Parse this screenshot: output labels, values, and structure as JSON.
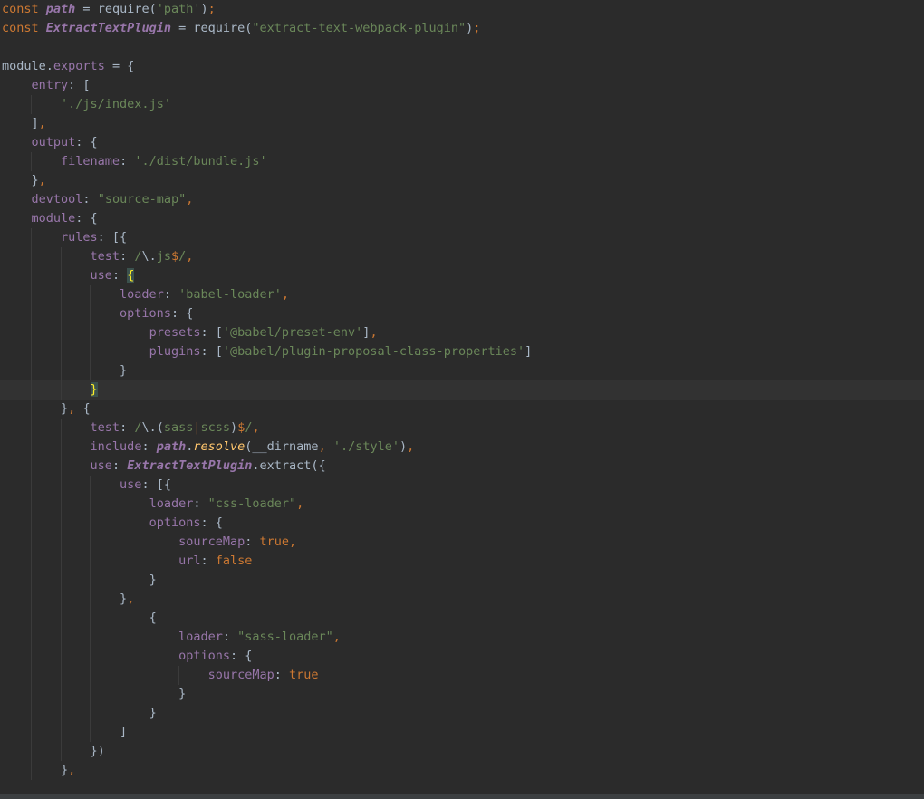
{
  "editor": {
    "language": "javascript",
    "current_line_index": 20,
    "lines": [
      [
        {
          "t": "const ",
          "c": "kw"
        },
        {
          "t": "path",
          "c": "globb"
        },
        {
          "t": " = ",
          "c": "plain"
        },
        {
          "t": "require",
          "c": "plain"
        },
        {
          "t": "(",
          "c": "plain"
        },
        {
          "t": "'path'",
          "c": "str"
        },
        {
          "t": ")",
          "c": "plain"
        },
        {
          "t": ";",
          "c": "punc"
        }
      ],
      [
        {
          "t": "const ",
          "c": "kw"
        },
        {
          "t": "ExtractTextPlugin",
          "c": "globb"
        },
        {
          "t": " = ",
          "c": "plain"
        },
        {
          "t": "require",
          "c": "plain"
        },
        {
          "t": "(",
          "c": "plain"
        },
        {
          "t": "\"extract-text-webpack-plugin\"",
          "c": "str"
        },
        {
          "t": ")",
          "c": "plain"
        },
        {
          "t": ";",
          "c": "punc"
        }
      ],
      [],
      [
        {
          "t": "module",
          "c": "plain"
        },
        {
          "t": ".",
          "c": "plain"
        },
        {
          "t": "exports",
          "c": "prop"
        },
        {
          "t": " = {",
          "c": "plain"
        }
      ],
      [
        {
          "t": "    ",
          "c": "plain"
        },
        {
          "t": "entry",
          "c": "prop"
        },
        {
          "t": ": [",
          "c": "plain"
        }
      ],
      [
        {
          "t": "        ",
          "c": "plain"
        },
        {
          "t": "'./js/index.js'",
          "c": "str"
        }
      ],
      [
        {
          "t": "    ",
          "c": "plain"
        },
        {
          "t": "]",
          "c": "plain"
        },
        {
          "t": ",",
          "c": "punc"
        }
      ],
      [
        {
          "t": "    ",
          "c": "plain"
        },
        {
          "t": "output",
          "c": "prop"
        },
        {
          "t": ": {",
          "c": "plain"
        }
      ],
      [
        {
          "t": "        ",
          "c": "plain"
        },
        {
          "t": "filename",
          "c": "prop"
        },
        {
          "t": ": ",
          "c": "plain"
        },
        {
          "t": "'./dist/bundle.js'",
          "c": "str"
        }
      ],
      [
        {
          "t": "    ",
          "c": "plain"
        },
        {
          "t": "}",
          "c": "plain"
        },
        {
          "t": ",",
          "c": "punc"
        }
      ],
      [
        {
          "t": "    ",
          "c": "plain"
        },
        {
          "t": "devtool",
          "c": "prop"
        },
        {
          "t": ": ",
          "c": "plain"
        },
        {
          "t": "\"source-map\"",
          "c": "str"
        },
        {
          "t": ",",
          "c": "punc"
        }
      ],
      [
        {
          "t": "    ",
          "c": "plain"
        },
        {
          "t": "module",
          "c": "prop"
        },
        {
          "t": ": {",
          "c": "plain"
        }
      ],
      [
        {
          "t": "        ",
          "c": "plain"
        },
        {
          "t": "rules",
          "c": "prop"
        },
        {
          "t": ": [{",
          "c": "plain"
        }
      ],
      [
        {
          "t": "            ",
          "c": "plain"
        },
        {
          "t": "test",
          "c": "prop"
        },
        {
          "t": ": ",
          "c": "plain"
        },
        {
          "t": "/",
          "c": "rx"
        },
        {
          "t": "\\.",
          "c": "plain"
        },
        {
          "t": "js",
          "c": "rx"
        },
        {
          "t": "$",
          "c": "rxs"
        },
        {
          "t": "/",
          "c": "rx"
        },
        {
          "t": ",",
          "c": "punc"
        }
      ],
      [
        {
          "t": "            ",
          "c": "plain"
        },
        {
          "t": "use",
          "c": "prop"
        },
        {
          "t": ": ",
          "c": "plain"
        },
        {
          "t": "{",
          "c": "brace-hl"
        }
      ],
      [
        {
          "t": "                ",
          "c": "plain"
        },
        {
          "t": "loader",
          "c": "prop"
        },
        {
          "t": ": ",
          "c": "plain"
        },
        {
          "t": "'babel-loader'",
          "c": "str"
        },
        {
          "t": ",",
          "c": "punc"
        }
      ],
      [
        {
          "t": "                ",
          "c": "plain"
        },
        {
          "t": "options",
          "c": "prop"
        },
        {
          "t": ": {",
          "c": "plain"
        }
      ],
      [
        {
          "t": "                    ",
          "c": "plain"
        },
        {
          "t": "presets",
          "c": "prop"
        },
        {
          "t": ": [",
          "c": "plain"
        },
        {
          "t": "'@babel/preset-env'",
          "c": "str"
        },
        {
          "t": "]",
          "c": "plain"
        },
        {
          "t": ",",
          "c": "punc"
        }
      ],
      [
        {
          "t": "                    ",
          "c": "plain"
        },
        {
          "t": "plugins",
          "c": "prop"
        },
        {
          "t": ": [",
          "c": "plain"
        },
        {
          "t": "'@babel/plugin-proposal-class-properties'",
          "c": "str"
        },
        {
          "t": "]",
          "c": "plain"
        }
      ],
      [
        {
          "t": "                ",
          "c": "plain"
        },
        {
          "t": "}",
          "c": "plain"
        }
      ],
      [
        {
          "t": "            ",
          "c": "plain"
        },
        {
          "t": "}",
          "c": "brace-hl"
        }
      ],
      [
        {
          "t": "        ",
          "c": "plain"
        },
        {
          "t": "}",
          "c": "plain"
        },
        {
          "t": ", ",
          "c": "punc"
        },
        {
          "t": "{",
          "c": "plain"
        }
      ],
      [
        {
          "t": "            ",
          "c": "plain"
        },
        {
          "t": "test",
          "c": "prop"
        },
        {
          "t": ": ",
          "c": "plain"
        },
        {
          "t": "/",
          "c": "rx"
        },
        {
          "t": "\\.",
          "c": "plain"
        },
        {
          "t": "(",
          "c": "plain"
        },
        {
          "t": "sass",
          "c": "rx"
        },
        {
          "t": "|",
          "c": "rxs"
        },
        {
          "t": "scss",
          "c": "rx"
        },
        {
          "t": ")",
          "c": "plain"
        },
        {
          "t": "$",
          "c": "rxs"
        },
        {
          "t": "/",
          "c": "rx"
        },
        {
          "t": ",",
          "c": "punc"
        }
      ],
      [
        {
          "t": "            ",
          "c": "plain"
        },
        {
          "t": "include",
          "c": "prop"
        },
        {
          "t": ": ",
          "c": "plain"
        },
        {
          "t": "path",
          "c": "globb"
        },
        {
          "t": ".",
          "c": "plain"
        },
        {
          "t": "resolve",
          "c": "fni"
        },
        {
          "t": "(__dirname",
          "c": "plain"
        },
        {
          "t": ", ",
          "c": "punc"
        },
        {
          "t": "'./style'",
          "c": "str"
        },
        {
          "t": ")",
          "c": "plain"
        },
        {
          "t": ",",
          "c": "punc"
        }
      ],
      [
        {
          "t": "            ",
          "c": "plain"
        },
        {
          "t": "use",
          "c": "prop"
        },
        {
          "t": ": ",
          "c": "plain"
        },
        {
          "t": "ExtractTextPlugin",
          "c": "globb"
        },
        {
          "t": ".",
          "c": "plain"
        },
        {
          "t": "extract",
          "c": "plain"
        },
        {
          "t": "({",
          "c": "plain"
        }
      ],
      [
        {
          "t": "                ",
          "c": "plain"
        },
        {
          "t": "use",
          "c": "prop"
        },
        {
          "t": ": [{",
          "c": "plain"
        }
      ],
      [
        {
          "t": "                    ",
          "c": "plain"
        },
        {
          "t": "loader",
          "c": "prop"
        },
        {
          "t": ": ",
          "c": "plain"
        },
        {
          "t": "\"css-loader\"",
          "c": "str"
        },
        {
          "t": ",",
          "c": "punc"
        }
      ],
      [
        {
          "t": "                    ",
          "c": "plain"
        },
        {
          "t": "options",
          "c": "prop"
        },
        {
          "t": ": {",
          "c": "plain"
        }
      ],
      [
        {
          "t": "                        ",
          "c": "plain"
        },
        {
          "t": "sourceMap",
          "c": "prop"
        },
        {
          "t": ": ",
          "c": "plain"
        },
        {
          "t": "true",
          "c": "bool"
        },
        {
          "t": ",",
          "c": "punc"
        }
      ],
      [
        {
          "t": "                        ",
          "c": "plain"
        },
        {
          "t": "url",
          "c": "prop"
        },
        {
          "t": ": ",
          "c": "plain"
        },
        {
          "t": "false",
          "c": "bool"
        }
      ],
      [
        {
          "t": "                    ",
          "c": "plain"
        },
        {
          "t": "}",
          "c": "plain"
        }
      ],
      [
        {
          "t": "                ",
          "c": "plain"
        },
        {
          "t": "}",
          "c": "plain"
        },
        {
          "t": ",",
          "c": "punc"
        }
      ],
      [
        {
          "t": "                    ",
          "c": "plain"
        },
        {
          "t": "{",
          "c": "plain"
        }
      ],
      [
        {
          "t": "                        ",
          "c": "plain"
        },
        {
          "t": "loader",
          "c": "prop"
        },
        {
          "t": ": ",
          "c": "plain"
        },
        {
          "t": "\"sass-loader\"",
          "c": "str"
        },
        {
          "t": ",",
          "c": "punc"
        }
      ],
      [
        {
          "t": "                        ",
          "c": "plain"
        },
        {
          "t": "options",
          "c": "prop"
        },
        {
          "t": ": {",
          "c": "plain"
        }
      ],
      [
        {
          "t": "                            ",
          "c": "plain"
        },
        {
          "t": "sourceMap",
          "c": "prop"
        },
        {
          "t": ": ",
          "c": "plain"
        },
        {
          "t": "true",
          "c": "bool"
        }
      ],
      [
        {
          "t": "                        ",
          "c": "plain"
        },
        {
          "t": "}",
          "c": "plain"
        }
      ],
      [
        {
          "t": "                    ",
          "c": "plain"
        },
        {
          "t": "}",
          "c": "plain"
        }
      ],
      [
        {
          "t": "                ",
          "c": "plain"
        },
        {
          "t": "]",
          "c": "plain"
        }
      ],
      [
        {
          "t": "            ",
          "c": "plain"
        },
        {
          "t": "})",
          "c": "plain"
        }
      ],
      [
        {
          "t": "        ",
          "c": "plain"
        },
        {
          "t": "}",
          "c": "plain"
        },
        {
          "t": ",",
          "c": "punc"
        }
      ]
    ]
  },
  "colors": {
    "background": "#2b2b2b",
    "current_line": "#323232",
    "keyword": "#cc7832",
    "string": "#6a8759",
    "property": "#9876aa",
    "plain": "#a9b7c6"
  }
}
